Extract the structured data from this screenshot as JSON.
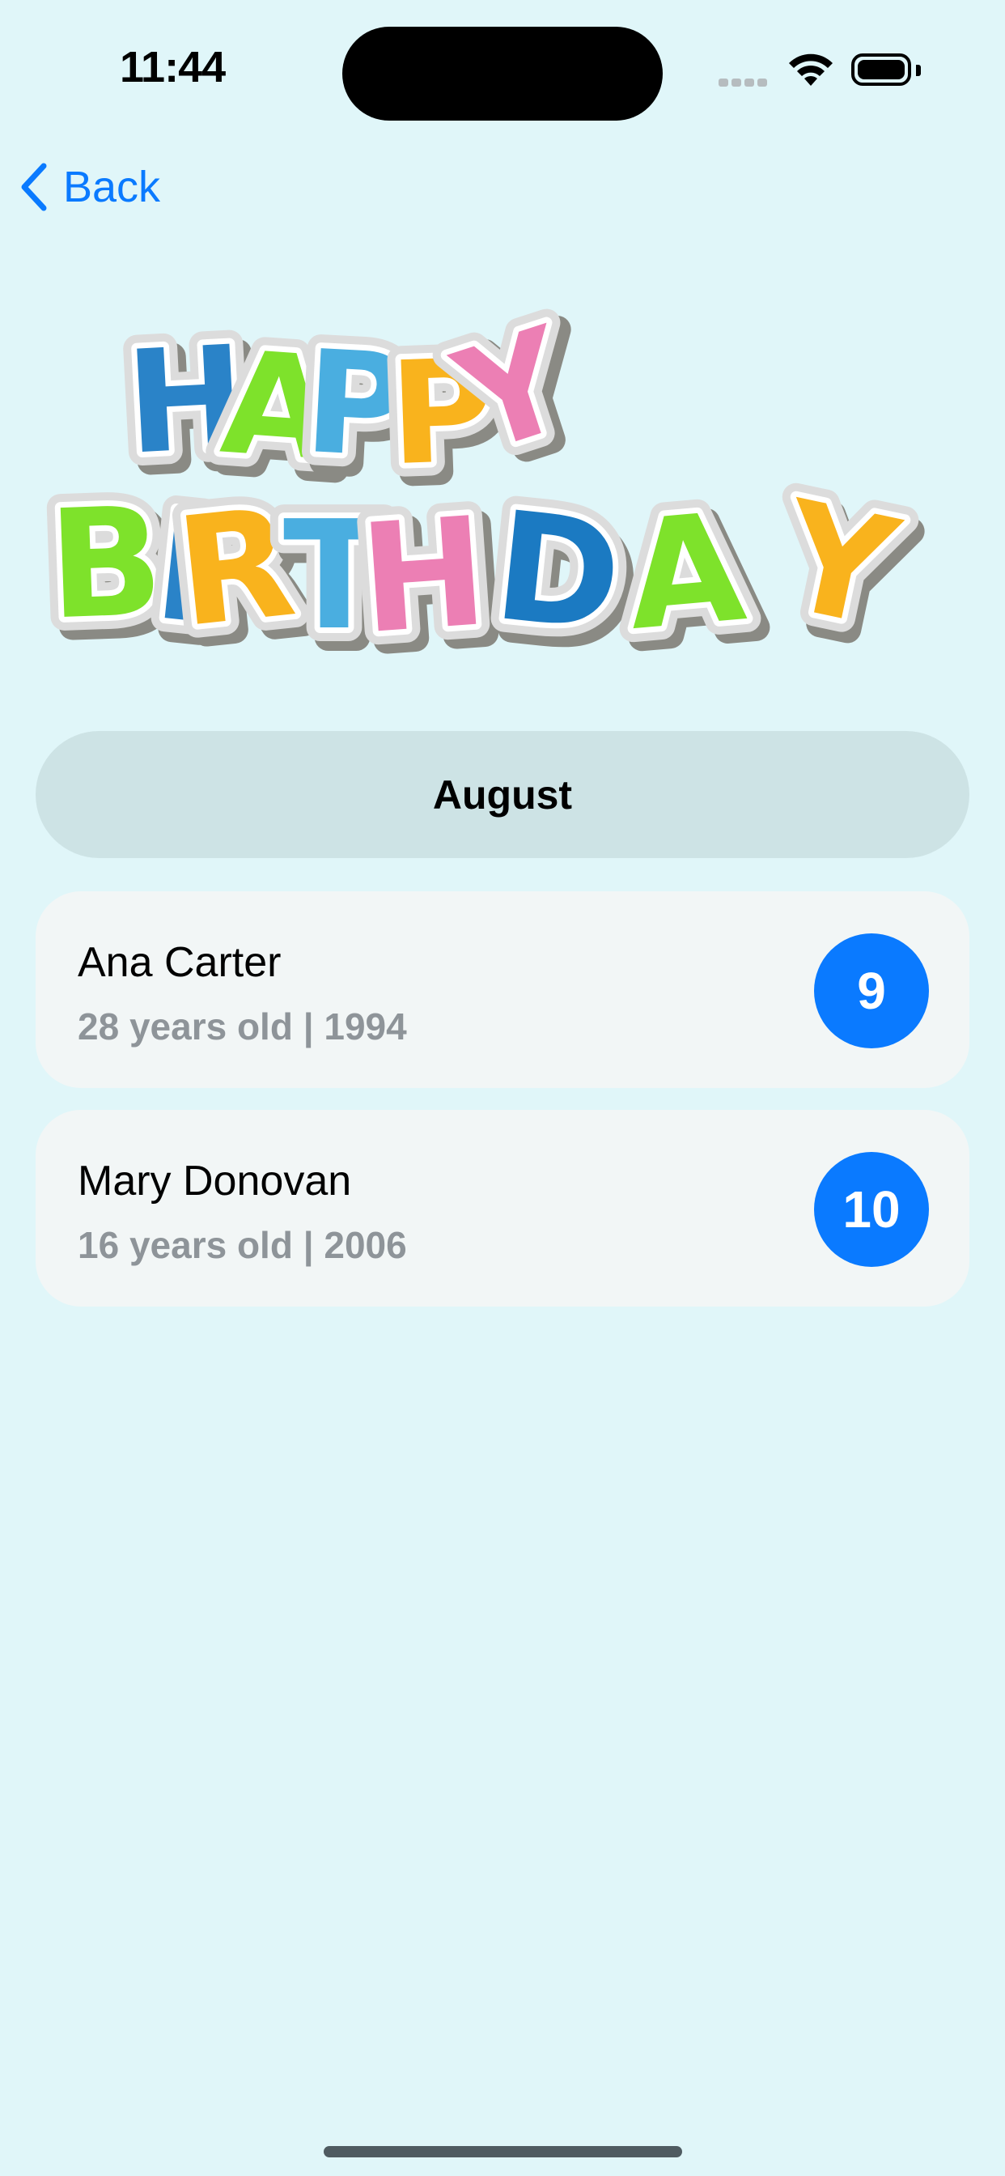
{
  "status_bar": {
    "time": "11:44"
  },
  "nav": {
    "back_label": "Back"
  },
  "banner": {
    "line1": [
      "H",
      "A",
      "P",
      "P",
      "Y"
    ],
    "line2": [
      "B",
      "I",
      "R",
      "T",
      "H",
      "D",
      "A",
      "Y"
    ],
    "palette": {
      "blue": "#2a83c8",
      "green": "#7ee22b",
      "light_blue": "#4aaee0",
      "yellow": "#f9b31d",
      "pink": "#ec7fb4",
      "dark_blue": "#1b7ac2"
    }
  },
  "section": {
    "month": "August"
  },
  "birthdays": [
    {
      "name": "Ana Carter",
      "details": "28 years old | 1994",
      "day": "9"
    },
    {
      "name": "Mary Donovan",
      "details": "16 years old | 2006",
      "day": "10"
    }
  ],
  "colors": {
    "accent": "#0a7aff",
    "background": "#e0f6f9"
  }
}
